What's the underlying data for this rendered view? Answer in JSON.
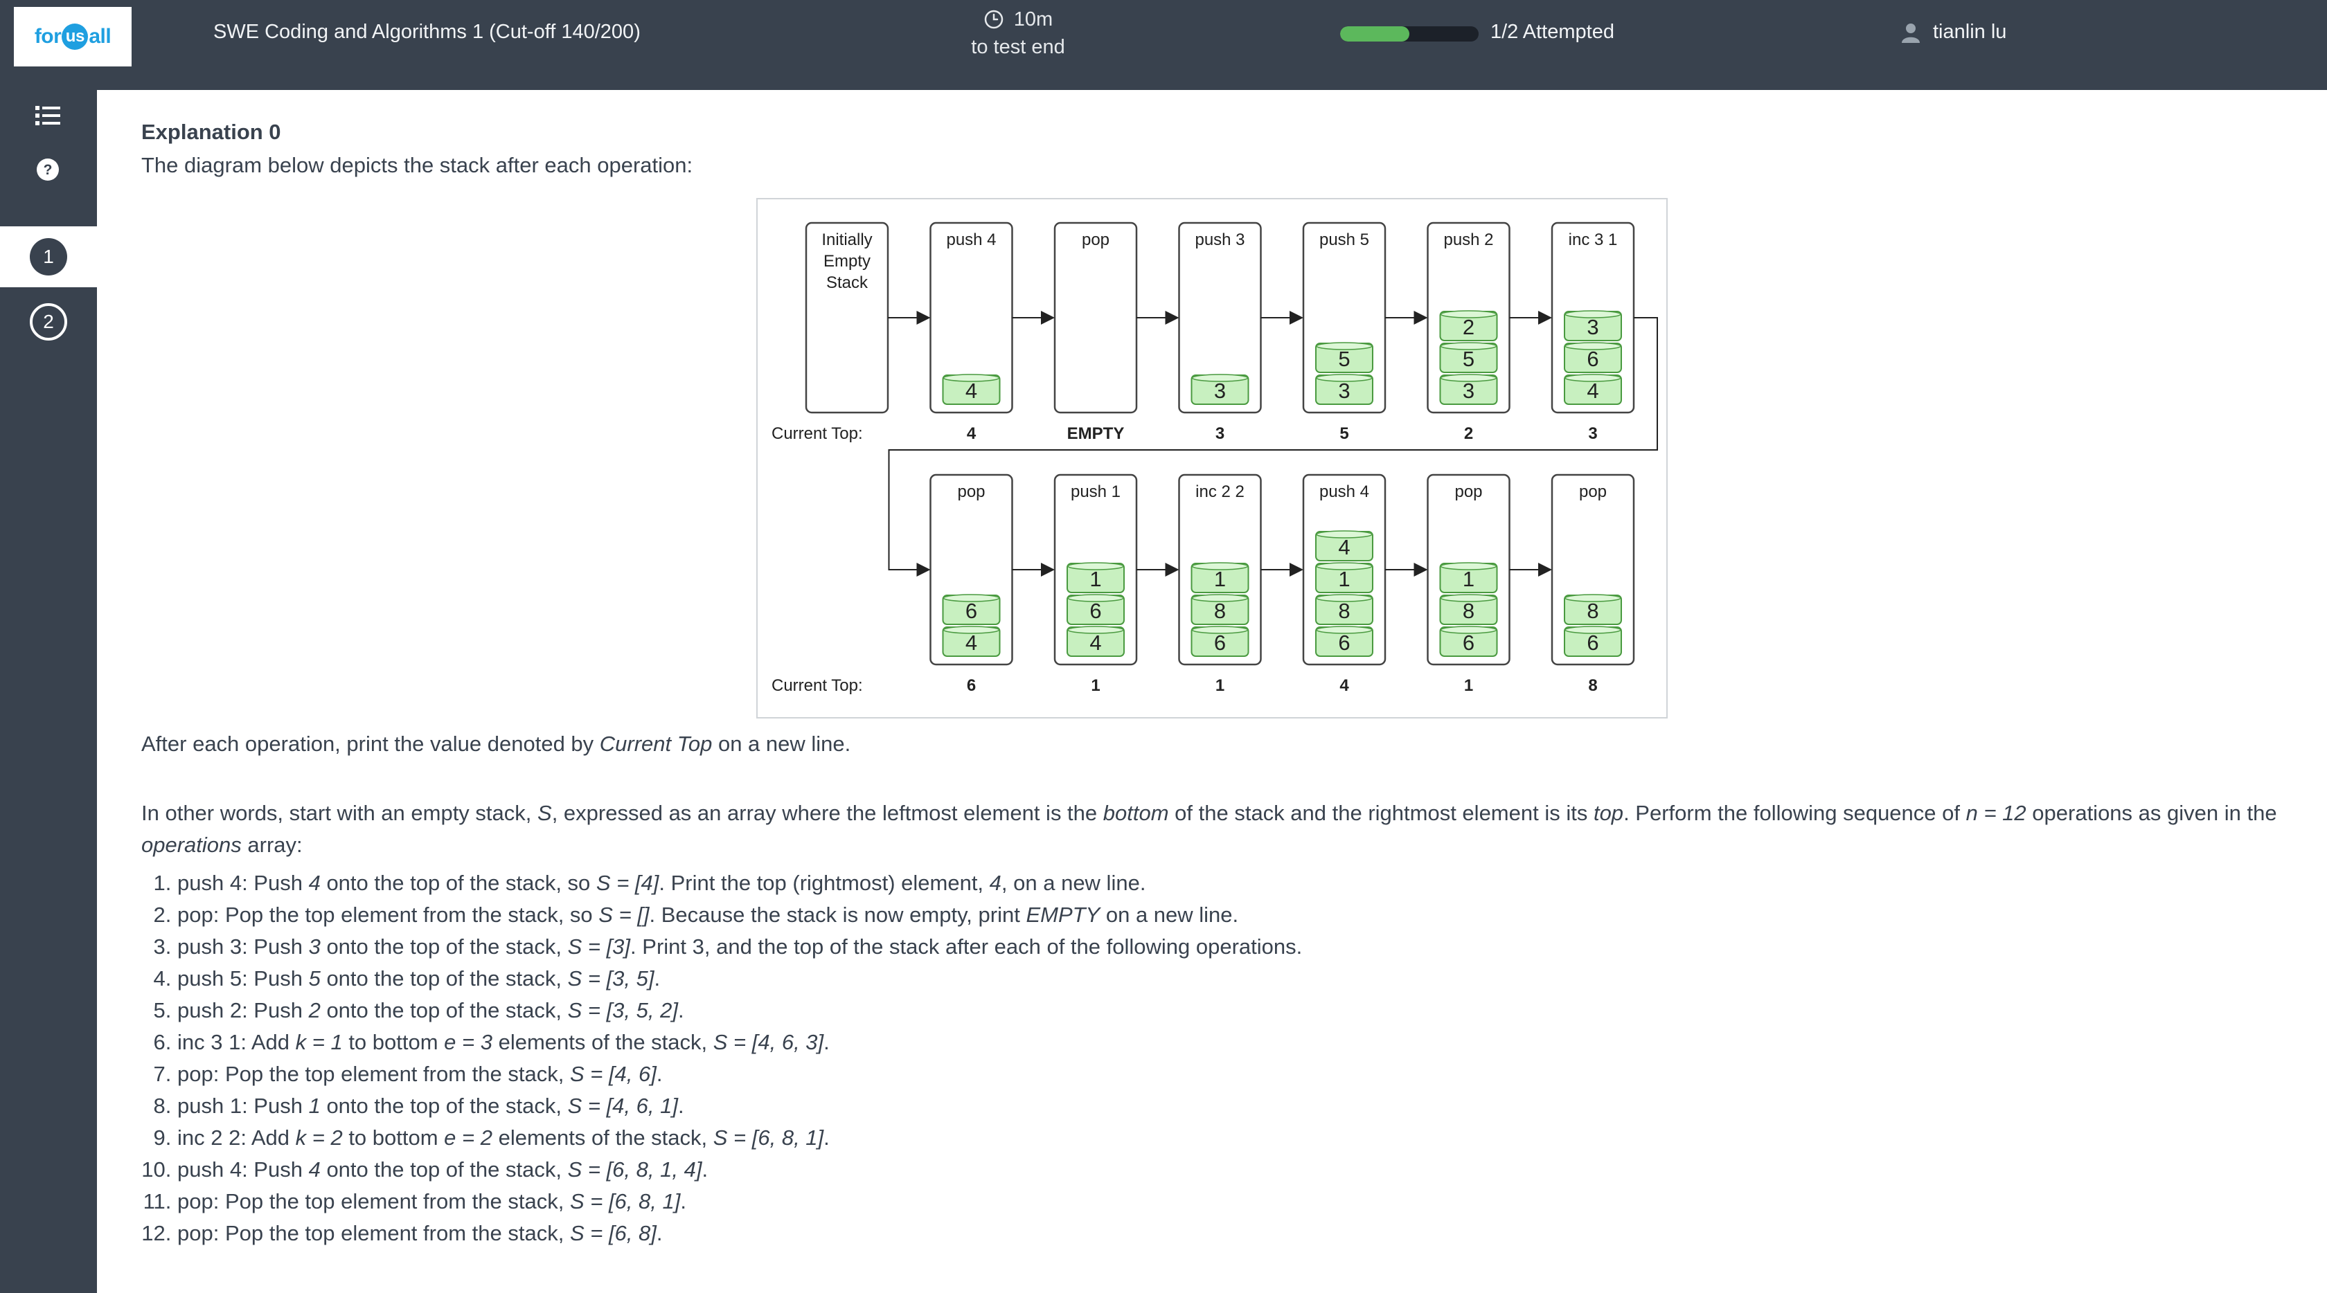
{
  "header": {
    "logo_text_left": "for",
    "logo_text_mid": "us",
    "logo_text_right": "all",
    "test_title": "SWE Coding and Algorithms 1 (Cut-off 140/200)",
    "timer_value": "10m",
    "timer_caption": "to test end",
    "progress_fraction": 0.5,
    "attempted": "1/2 Attempted",
    "user_name": "tianlin lu"
  },
  "sidebar": {
    "questions": [
      {
        "number": "1",
        "active": true
      },
      {
        "number": "2",
        "active": false
      }
    ]
  },
  "explanation": {
    "title": "Explanation 0",
    "intro": "The diagram below depicts the stack after each operation:",
    "after_pre": "After each operation, print the value denoted by ",
    "after_em": "Current Top",
    "after_post": " on a new line.",
    "ow_1": "In other words, start with an empty stack, ",
    "ow_S": "S",
    "ow_2": ", expressed as an array where the leftmost element is the ",
    "ow_bottom": "bottom",
    "ow_3": " of the stack and the rightmost element is its ",
    "ow_top": "top",
    "ow_4": ". Perform the following sequence of ",
    "ow_n": "n = 12",
    "ow_5": " operations as given in the ",
    "ow_ops": "operations",
    "ow_6": " array:"
  },
  "operations_list": [
    [
      {
        "t": "push 4: Push "
      },
      {
        "t": "4",
        "i": true
      },
      {
        "t": " onto the top of the stack, so "
      },
      {
        "t": "S = [4]",
        "i": true
      },
      {
        "t": ". Print the top (rightmost) element, "
      },
      {
        "t": "4",
        "i": true
      },
      {
        "t": ", on a new line."
      }
    ],
    [
      {
        "t": "pop: Pop the top element from the stack, so "
      },
      {
        "t": "S = []",
        "i": true
      },
      {
        "t": ". Because the stack is now empty, print "
      },
      {
        "t": "EMPTY",
        "i": true
      },
      {
        "t": " on a new line."
      }
    ],
    [
      {
        "t": "push 3: Push "
      },
      {
        "t": "3",
        "i": true
      },
      {
        "t": " onto the top of the stack, "
      },
      {
        "t": "S = [3]",
        "i": true
      },
      {
        "t": ". Print 3, and the top of the stack after each of the following operations."
      }
    ],
    [
      {
        "t": "push 5: Push "
      },
      {
        "t": "5",
        "i": true
      },
      {
        "t": " onto the top of the stack, "
      },
      {
        "t": "S = [3, 5]",
        "i": true
      },
      {
        "t": "."
      }
    ],
    [
      {
        "t": "push 2: Push "
      },
      {
        "t": "2",
        "i": true
      },
      {
        "t": " onto the top of the stack, "
      },
      {
        "t": "S = [3, 5, 2]",
        "i": true
      },
      {
        "t": "."
      }
    ],
    [
      {
        "t": "inc 3 1: Add "
      },
      {
        "t": "k = 1",
        "i": true
      },
      {
        "t": " to bottom "
      },
      {
        "t": "e = 3",
        "i": true
      },
      {
        "t": " elements of the stack, "
      },
      {
        "t": "S = [4, 6, 3]",
        "i": true
      },
      {
        "t": "."
      }
    ],
    [
      {
        "t": "pop: Pop the top element from the stack, "
      },
      {
        "t": "S = [4, 6]",
        "i": true
      },
      {
        "t": "."
      }
    ],
    [
      {
        "t": "push 1: Push "
      },
      {
        "t": "1",
        "i": true
      },
      {
        "t": " onto the top of the stack, "
      },
      {
        "t": "S = [4, 6, 1]",
        "i": true
      },
      {
        "t": "."
      }
    ],
    [
      {
        "t": "inc 2 2: Add "
      },
      {
        "t": "k = 2",
        "i": true
      },
      {
        "t": " to bottom "
      },
      {
        "t": "e = 2",
        "i": true
      },
      {
        "t": " elements of the stack,  "
      },
      {
        "t": "S = [6, 8, 1]",
        "i": true
      },
      {
        "t": "."
      }
    ],
    [
      {
        "t": "push 4: Push "
      },
      {
        "t": "4",
        "i": true
      },
      {
        "t": " onto the top of the stack, "
      },
      {
        "t": "S = [6, 8, 1, 4]",
        "i": true
      },
      {
        "t": "."
      }
    ],
    [
      {
        "t": "pop: Pop the top element from the stack, "
      },
      {
        "t": "S = [6, 8, 1]",
        "i": true
      },
      {
        "t": "."
      }
    ],
    [
      {
        "t": "pop: Pop the top element from the stack, "
      },
      {
        "t": "S = [6, 8]",
        "i": true
      },
      {
        "t": "."
      }
    ]
  ],
  "diagram": {
    "current_top_label": "Current Top:",
    "rows": [
      [
        {
          "label": [
            "Initially",
            "Empty",
            "Stack"
          ],
          "stack": [],
          "top": ""
        },
        {
          "label": [
            "push 4"
          ],
          "stack": [
            "4"
          ],
          "top": "4"
        },
        {
          "label": [
            "pop"
          ],
          "stack": [],
          "top": "EMPTY"
        },
        {
          "label": [
            "push 3"
          ],
          "stack": [
            "3"
          ],
          "top": "3"
        },
        {
          "label": [
            "push 5"
          ],
          "stack": [
            "3",
            "5"
          ],
          "top": "5"
        },
        {
          "label": [
            "push 2"
          ],
          "stack": [
            "3",
            "5",
            "2"
          ],
          "top": "2"
        },
        {
          "label": [
            "inc 3 1"
          ],
          "stack": [
            "4",
            "6",
            "3"
          ],
          "top": "3"
        }
      ],
      [
        {
          "label": [
            "pop"
          ],
          "stack": [
            "4",
            "6"
          ],
          "top": "6"
        },
        {
          "label": [
            "push 1"
          ],
          "stack": [
            "4",
            "6",
            "1"
          ],
          "top": "1"
        },
        {
          "label": [
            "inc 2 2"
          ],
          "stack": [
            "6",
            "8",
            "1"
          ],
          "top": "1"
        },
        {
          "label": [
            "push 4"
          ],
          "stack": [
            "6",
            "8",
            "1",
            "4"
          ],
          "top": "4"
        },
        {
          "label": [
            "pop"
          ],
          "stack": [
            "6",
            "8",
            "1"
          ],
          "top": "1"
        },
        {
          "label": [
            "pop"
          ],
          "stack": [
            "6",
            "8"
          ],
          "top": "8"
        }
      ]
    ]
  },
  "colors": {
    "header_bg": "#39424e",
    "accent_green": "#5cb85c",
    "stack_item_fill": "#c8f0c0",
    "stack_item_stroke": "#4a9a40",
    "logo_blue": "#1f9fe0"
  },
  "icons": [
    "clock-icon",
    "user-icon",
    "list-icon",
    "help-icon"
  ]
}
